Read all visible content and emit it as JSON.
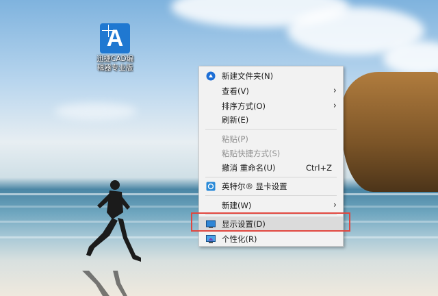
{
  "desktop_icon": {
    "app_letter": "A",
    "caption": "迅捷CAD编辑器专业版"
  },
  "context_menu": {
    "items": [
      {
        "label": "新建文件夹(N)",
        "icon": "new-folder-icon"
      },
      {
        "label": "查看(V)",
        "submenu": "›"
      },
      {
        "label": "排序方式(O)",
        "submenu": "›"
      },
      {
        "label": "刷新(E)"
      },
      {
        "label": "粘贴(P)",
        "disabled": true
      },
      {
        "label": "粘贴快捷方式(S)",
        "disabled": true
      },
      {
        "label": "撤消 重命名(U)",
        "shortcut": "Ctrl+Z"
      },
      {
        "label": "英特尔® 显卡设置",
        "icon": "intel-graphics-icon"
      },
      {
        "label": "新建(W)",
        "submenu": "›"
      },
      {
        "label": "显示设置(D)",
        "icon": "display-settings-icon",
        "highlighted": true
      },
      {
        "label": "个性化(R)",
        "icon": "personalize-icon"
      }
    ]
  },
  "colors": {
    "annotation_box": "#e0463e",
    "menu_bg": "#f2f2f2",
    "icon_tile": "#1f78d1"
  }
}
